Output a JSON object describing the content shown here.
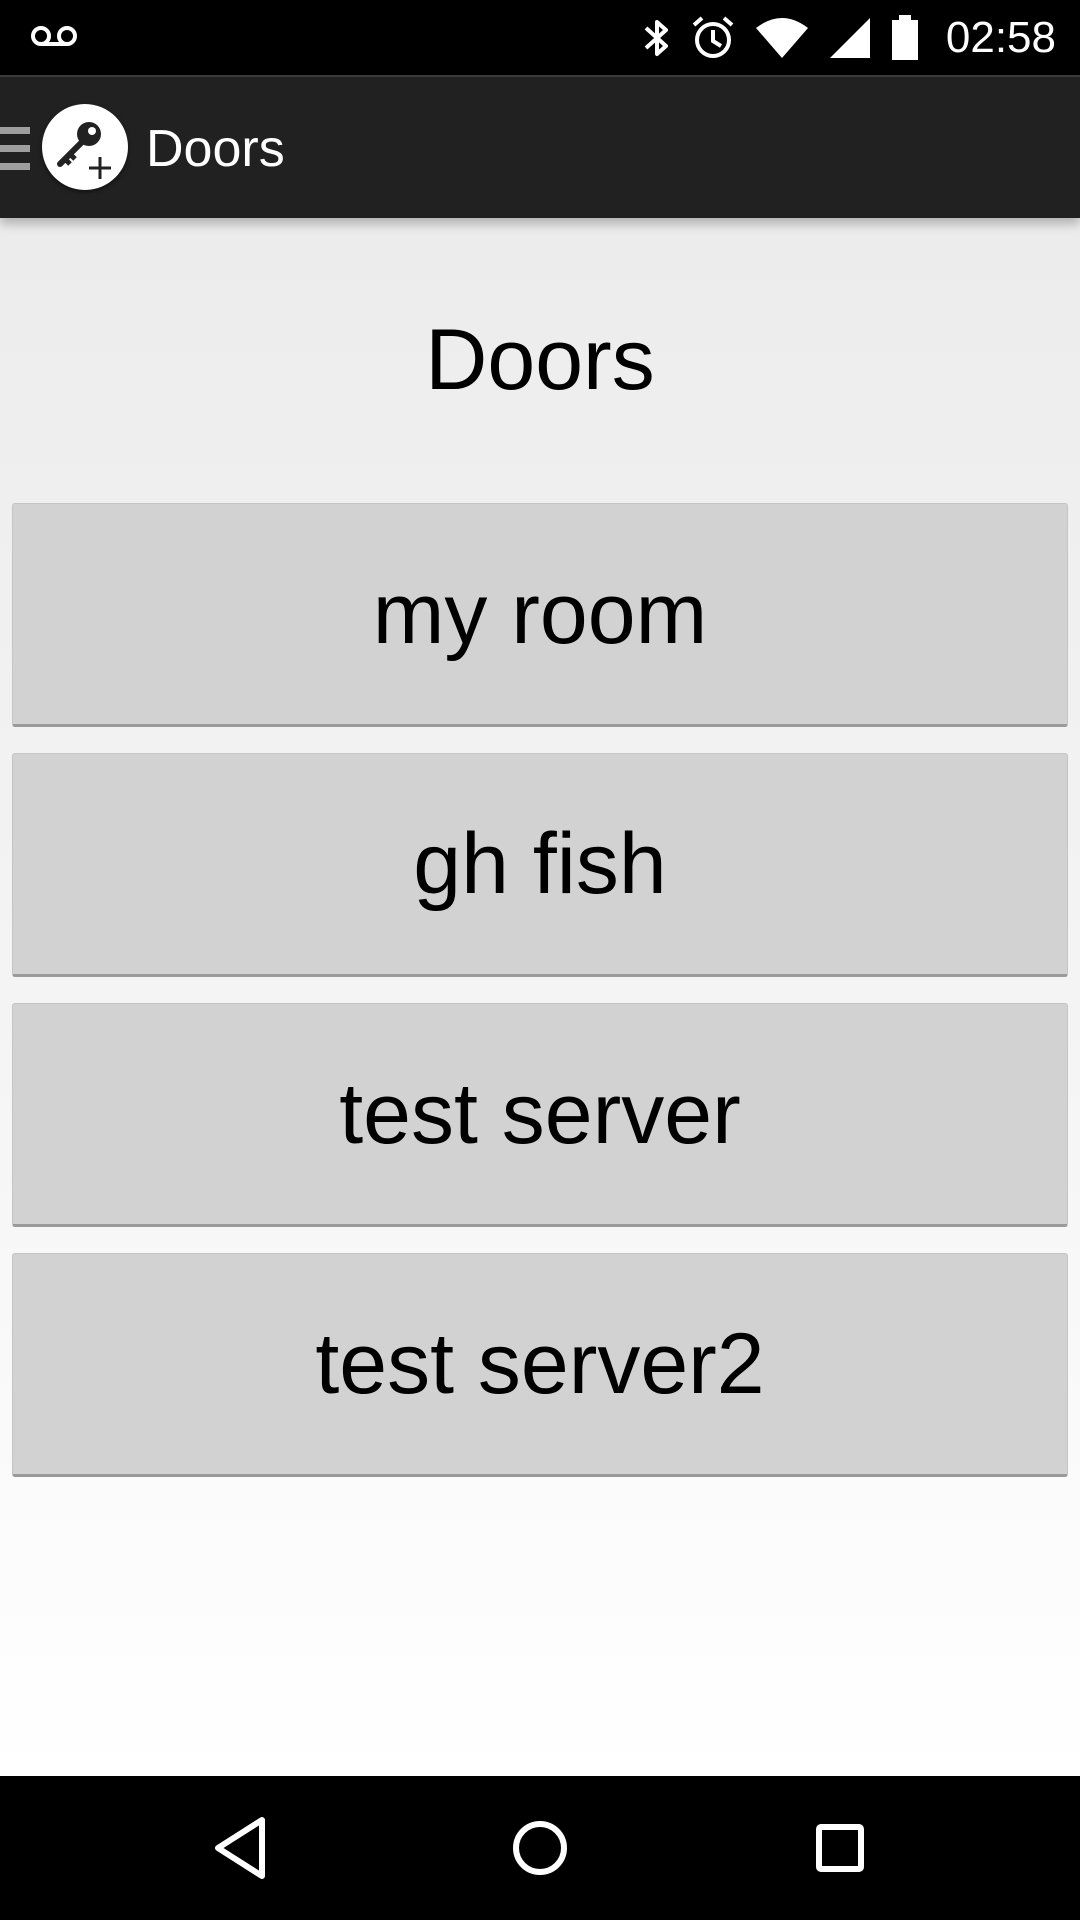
{
  "status_bar": {
    "time": "02:58",
    "icons": [
      "voicemail-icon",
      "bluetooth-icon",
      "alarm-icon",
      "wifi-icon",
      "signal-icon",
      "battery-icon"
    ]
  },
  "app_bar": {
    "title": "Doors",
    "logo_icon": "key-plus-icon",
    "drawer_icon": "hamburger-icon"
  },
  "main": {
    "heading": "Doors",
    "doors": [
      {
        "label": "my room"
      },
      {
        "label": "gh fish"
      },
      {
        "label": "test server"
      },
      {
        "label": "test server2"
      }
    ]
  },
  "nav_bar": {
    "icons": [
      "back-icon",
      "home-icon",
      "recents-icon"
    ]
  },
  "colors": {
    "status_bar": "#000000",
    "app_bar": "#212121",
    "button": "#d2d2d2",
    "nav_bar": "#000000"
  }
}
